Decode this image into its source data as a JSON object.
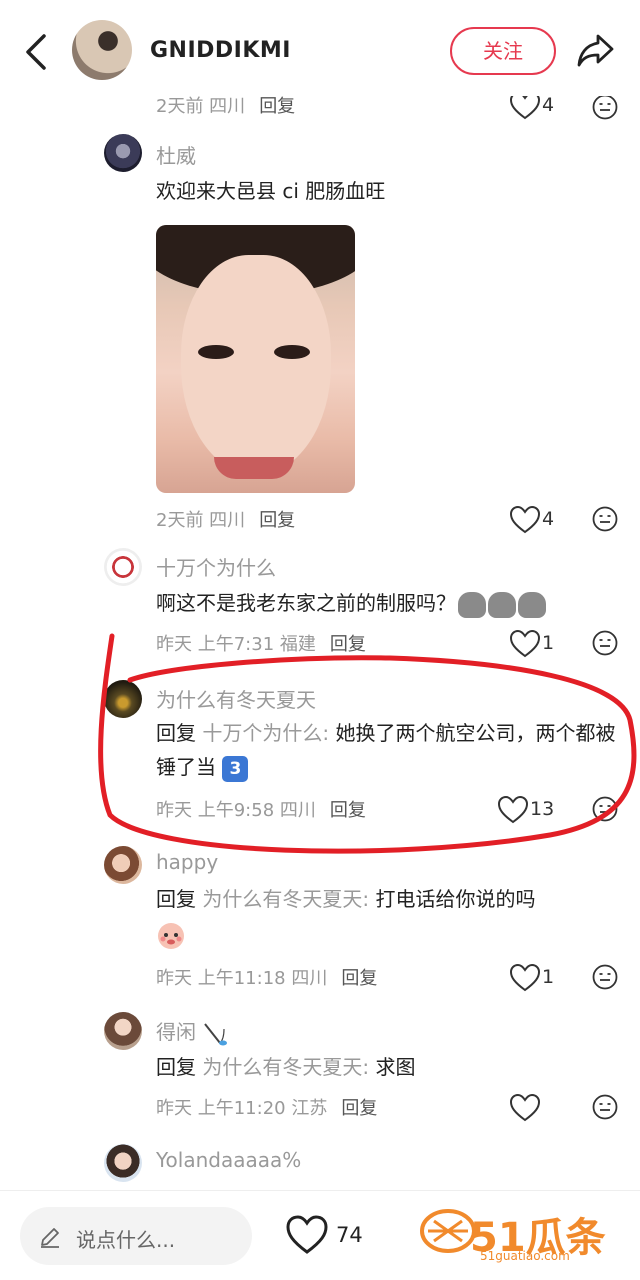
{
  "header": {
    "username": "GNIDDIKMI",
    "follow_label": "关注"
  },
  "comments": [
    {
      "meta_time": "2天前 四川",
      "reply_label": "回复",
      "likes": "4"
    },
    {
      "author": "杜威",
      "text": "欢迎来大邑县 ci 肥肠血旺",
      "meta_time": "2天前 四川",
      "reply_label": "回复",
      "likes": "4"
    },
    {
      "author": "十万个为什么",
      "text": "啊这不是我老东家之前的制服吗？",
      "meta_time": "昨天 上午7:31 福建",
      "reply_label": "回复",
      "likes": "1"
    },
    {
      "author": "为什么有冬天夏天",
      "reply_prefix": "回复",
      "reply_to": "十万个为什么:",
      "text": " 她换了两个航空公司，两个都被锤了当",
      "meta_time": "昨天 上午9:58 四川",
      "reply_label": "回复",
      "likes": "13"
    },
    {
      "author": "happy",
      "reply_prefix": "回复",
      "reply_to": "为什么有冬天夏天:",
      "text": " 打电话给你说的吗",
      "meta_time": "昨天 上午11:18 四川",
      "reply_label": "回复",
      "likes": "1"
    },
    {
      "author": "得闲",
      "reply_prefix": "回复",
      "reply_to": "为什么有冬天夏天:",
      "text": " 求图",
      "meta_time": "昨天 上午11:20 江苏",
      "reply_label": "回复",
      "likes": ""
    },
    {
      "author": "Yolandaaaaa%"
    }
  ],
  "bottom": {
    "input_placeholder": "说点什么...",
    "like_count": "74",
    "watermark_main": "51瓜条",
    "watermark_sub": "51guatiao.com"
  },
  "colors": {
    "accent": "#e6394f",
    "watermark": "#f18a2c"
  }
}
